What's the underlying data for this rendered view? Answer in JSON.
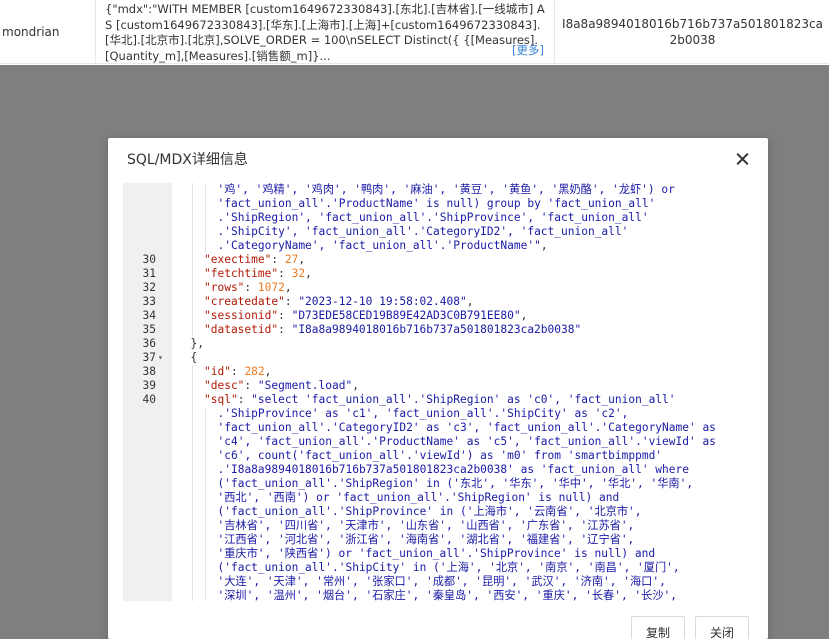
{
  "background_row": {
    "user": "mondrian",
    "mdx": "{\"mdx\":\"WITH MEMBER [custom1649672330843].[东北].[吉林省].[一线城市] AS [custom1649672330843].[华东].[上海市].[上海]+[custom1649672330843].[华北].[北京市].[北京],SOLVE_ORDER = 100\\nSELECT Distinct({ {[Measures].[Quantity_m],[Measures].[销售额_m]}...",
    "more": "[更多]",
    "datasetid": "I8a8a9894018016b716b737a501801823ca2b0038"
  },
  "modal": {
    "title": "SQL/MDX详细信息",
    "copy_label": "复制",
    "close_label": "关闭"
  },
  "code_lines": [
    {
      "ln": "",
      "fold": "",
      "indent": 3,
      "parts": [
        [
          "s",
          "'鸡', '鸡精', '鸡肉', '鸭肉', '麻油', '黄豆', '黄鱼', '黑奶酪', '龙虾') or"
        ]
      ]
    },
    {
      "ln": "",
      "fold": "",
      "indent": 3,
      "parts": [
        [
          "s",
          "'fact_union_all'.'ProductName' is null) group by 'fact_union_all'"
        ]
      ]
    },
    {
      "ln": "",
      "fold": "",
      "indent": 3,
      "parts": [
        [
          "s",
          ".'ShipRegion', 'fact_union_all'.'ShipProvince', 'fact_union_all'"
        ]
      ]
    },
    {
      "ln": "",
      "fold": "",
      "indent": 3,
      "parts": [
        [
          "s",
          ".'ShipCity', 'fact_union_all'.'CategoryID2', 'fact_union_all'"
        ]
      ]
    },
    {
      "ln": "",
      "fold": "",
      "indent": 3,
      "parts": [
        [
          "s",
          ".'CategoryName', 'fact_union_all'.'ProductName'\""
        ],
        [
          "p",
          ","
        ]
      ]
    },
    {
      "ln": "30",
      "fold": "",
      "indent": 2,
      "parts": [
        [
          "k",
          "\"exectime\""
        ],
        [
          "p",
          ": "
        ],
        [
          "n",
          "27"
        ],
        [
          "p",
          ","
        ]
      ]
    },
    {
      "ln": "31",
      "fold": "",
      "indent": 2,
      "parts": [
        [
          "k",
          "\"fetchtime\""
        ],
        [
          "p",
          ": "
        ],
        [
          "n",
          "32"
        ],
        [
          "p",
          ","
        ]
      ]
    },
    {
      "ln": "32",
      "fold": "",
      "indent": 2,
      "parts": [
        [
          "k",
          "\"rows\""
        ],
        [
          "p",
          ": "
        ],
        [
          "n",
          "1072"
        ],
        [
          "p",
          ","
        ]
      ]
    },
    {
      "ln": "33",
      "fold": "",
      "indent": 2,
      "parts": [
        [
          "k",
          "\"createdate\""
        ],
        [
          "p",
          ": "
        ],
        [
          "s",
          "\"2023-12-10 19:58:02.408\""
        ],
        [
          "p",
          ","
        ]
      ]
    },
    {
      "ln": "34",
      "fold": "",
      "indent": 2,
      "parts": [
        [
          "k",
          "\"sessionid\""
        ],
        [
          "p",
          ": "
        ],
        [
          "s",
          "\"D73EDE58CED19B89E42AD3C0B791EE80\""
        ],
        [
          "p",
          ","
        ]
      ]
    },
    {
      "ln": "35",
      "fold": "",
      "indent": 2,
      "parts": [
        [
          "k",
          "\"datasetid\""
        ],
        [
          "p",
          ": "
        ],
        [
          "s",
          "\"I8a8a9894018016b716b737a501801823ca2b0038\""
        ]
      ]
    },
    {
      "ln": "36",
      "fold": "",
      "indent": 1,
      "parts": [
        [
          "p",
          "},"
        ]
      ]
    },
    {
      "ln": "37",
      "fold": "▾",
      "indent": 1,
      "parts": [
        [
          "p",
          "{"
        ]
      ]
    },
    {
      "ln": "38",
      "fold": "",
      "indent": 2,
      "parts": [
        [
          "k",
          "\"id\""
        ],
        [
          "p",
          ": "
        ],
        [
          "n",
          "282"
        ],
        [
          "p",
          ","
        ]
      ]
    },
    {
      "ln": "39",
      "fold": "",
      "indent": 2,
      "parts": [
        [
          "k",
          "\"desc\""
        ],
        [
          "p",
          ": "
        ],
        [
          "s",
          "\"Segment.load\""
        ],
        [
          "p",
          ","
        ]
      ]
    },
    {
      "ln": "40",
      "fold": "",
      "indent": 2,
      "parts": [
        [
          "k",
          "\"sql\""
        ],
        [
          "p",
          ": "
        ],
        [
          "s",
          "\"select 'fact_union_all'.'ShipRegion' as 'c0', 'fact_union_all'"
        ]
      ]
    },
    {
      "ln": "",
      "fold": "",
      "indent": 3,
      "parts": [
        [
          "s",
          ".'ShipProvince' as 'c1', 'fact_union_all'.'ShipCity' as 'c2',"
        ]
      ]
    },
    {
      "ln": "",
      "fold": "",
      "indent": 3,
      "parts": [
        [
          "s",
          "'fact_union_all'.'CategoryID2' as 'c3', 'fact_union_all'.'CategoryName' as"
        ]
      ]
    },
    {
      "ln": "",
      "fold": "",
      "indent": 3,
      "parts": [
        [
          "s",
          "'c4', 'fact_union_all'.'ProductName' as 'c5', 'fact_union_all'.'viewId' as"
        ]
      ]
    },
    {
      "ln": "",
      "fold": "",
      "indent": 3,
      "parts": [
        [
          "s",
          "'c6', count('fact_union_all'.'viewId') as 'm0' from 'smartbimppmd'"
        ]
      ]
    },
    {
      "ln": "",
      "fold": "",
      "indent": 3,
      "parts": [
        [
          "s",
          ".'I8a8a9894018016b716b737a501801823ca2b0038' as 'fact_union_all' where"
        ]
      ]
    },
    {
      "ln": "",
      "fold": "",
      "indent": 3,
      "parts": [
        [
          "s",
          "('fact_union_all'.'ShipRegion' in ('东北', '华东', '华中', '华北', '华南',"
        ]
      ]
    },
    {
      "ln": "",
      "fold": "",
      "indent": 3,
      "parts": [
        [
          "s",
          "'西北', '西南') or 'fact_union_all'.'ShipRegion' is null) and"
        ]
      ]
    },
    {
      "ln": "",
      "fold": "",
      "indent": 3,
      "parts": [
        [
          "s",
          "('fact_union_all'.'ShipProvince' in ('上海市', '云南省', '北京市',"
        ]
      ]
    },
    {
      "ln": "",
      "fold": "",
      "indent": 3,
      "parts": [
        [
          "s",
          "'吉林省', '四川省', '天津市', '山东省', '山西省', '广东省', '江苏省',"
        ]
      ]
    },
    {
      "ln": "",
      "fold": "",
      "indent": 3,
      "parts": [
        [
          "s",
          "'江西省', '河北省', '浙江省', '海南省', '湖北省', '福建省', '辽宁省',"
        ]
      ]
    },
    {
      "ln": "",
      "fold": "",
      "indent": 3,
      "parts": [
        [
          "s",
          "'重庆市', '陕西省') or 'fact_union_all'.'ShipProvince' is null) and"
        ]
      ]
    },
    {
      "ln": "",
      "fold": "",
      "indent": 3,
      "parts": [
        [
          "s",
          "('fact_union_all'.'ShipCity' in ('上海', '北京', '南京', '南昌', '厦门',"
        ]
      ]
    },
    {
      "ln": "",
      "fold": "",
      "indent": 3,
      "parts": [
        [
          "s",
          "'大连', '天津', '常州', '张家口', '成都', '昆明', '武汉', '济南', '海口',"
        ]
      ]
    },
    {
      "ln": "",
      "fold": "",
      "indent": 3,
      "parts": [
        [
          "s",
          "'深圳', '温州', '烟台', '石家庄', '秦皇岛', '西安', '重庆', '长春', '长沙',"
        ]
      ]
    }
  ]
}
